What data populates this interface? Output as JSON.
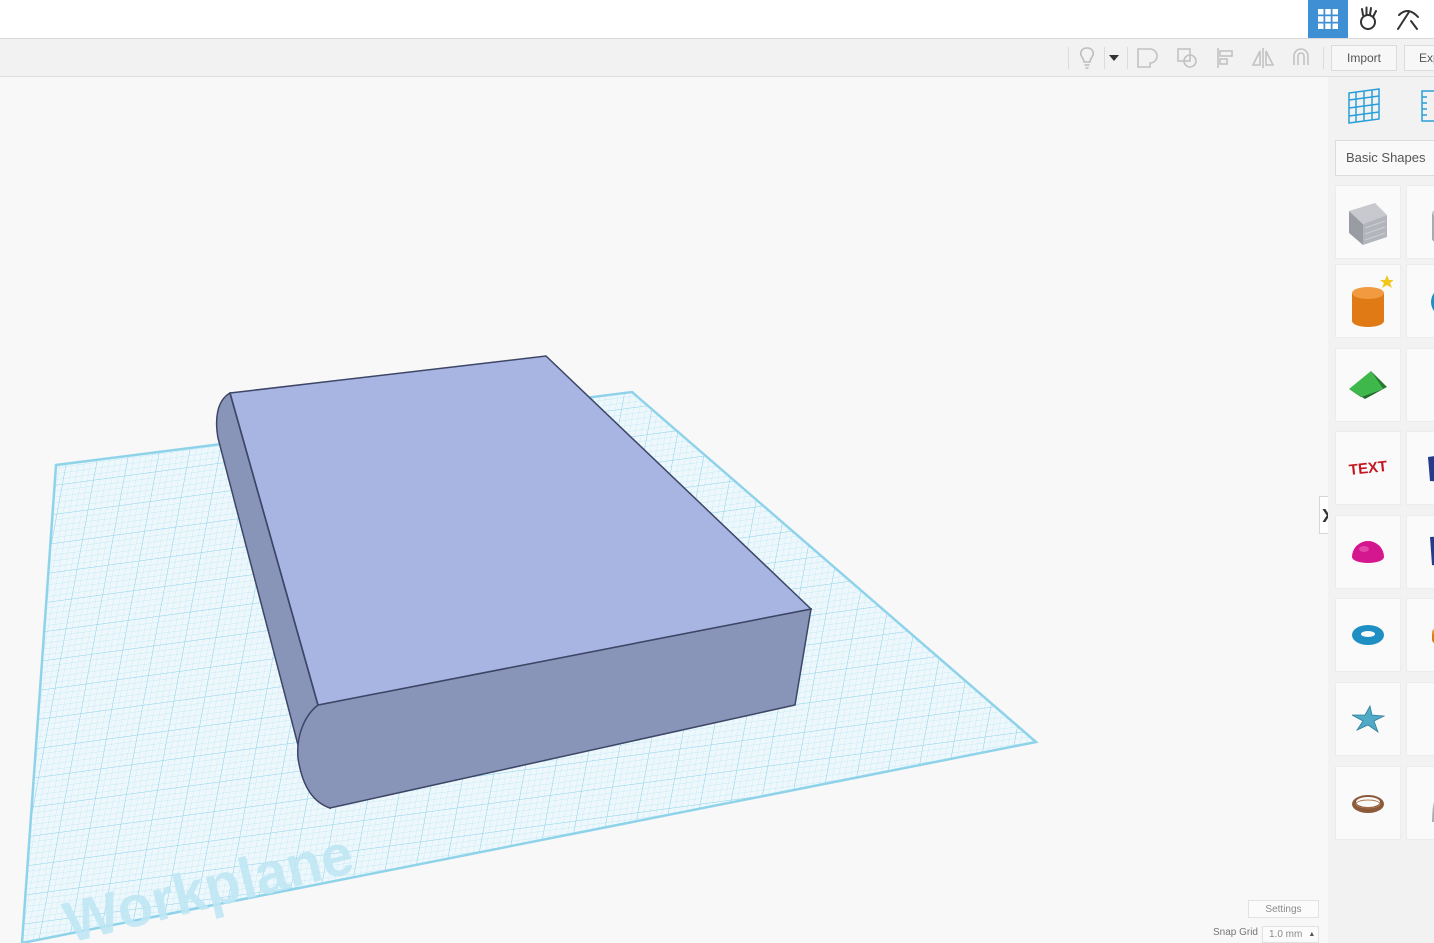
{
  "topbar": {
    "buttons": [
      {
        "name": "3d-design-view",
        "icon": "grid-icon",
        "active": true
      },
      {
        "name": "bricks-view",
        "icon": "hand-icon",
        "active": false
      },
      {
        "name": "blocks-view",
        "icon": "pickaxe-icon",
        "active": false
      }
    ]
  },
  "toolbar": {
    "icons": [
      "lightbulb-icon",
      "dropdown-caret-icon",
      "group-icon",
      "ungroup-icon",
      "align-icon",
      "mirror-icon",
      "magnet-icon"
    ],
    "import_label": "Import",
    "export_label": "Exp"
  },
  "canvas": {
    "workplane_label": "Workplane",
    "shape": {
      "type": "rounded-box",
      "top_color": "#a8b5e2",
      "side_color": "#8894b8"
    },
    "grid_color": "#8fd3ea"
  },
  "panel": {
    "category_label": "Basic Shapes",
    "view_icons": [
      "workplane-icon",
      "ruler-icon"
    ],
    "shapes": [
      {
        "name": "box",
        "color": "#a9abb3"
      },
      {
        "name": "cylinder-partial",
        "color": "#a9abb3"
      },
      {
        "name": "cylinder",
        "color": "#e8841f"
      },
      {
        "name": "sphere-partial",
        "color": "#1e8fc3"
      },
      {
        "name": "roof",
        "color": "#2e9e3a"
      },
      {
        "name": "cone-partial",
        "color": "#7b2d94"
      },
      {
        "name": "text",
        "color": "#cc1f2b"
      },
      {
        "name": "wedge-partial",
        "color": "#263b8c"
      },
      {
        "name": "half-sphere",
        "color": "#d4168f"
      },
      {
        "name": "pyramid-partial",
        "color": "#263b8c"
      },
      {
        "name": "torus",
        "color": "#1e8fc3"
      },
      {
        "name": "tube-partial",
        "color": "#e8841f"
      },
      {
        "name": "star",
        "color": "#4fa9c7"
      },
      {
        "name": "polygon-partial",
        "color": "#e8d51f"
      },
      {
        "name": "ring",
        "color": "#8a5a3a"
      },
      {
        "name": "paraboloid-partial",
        "color": "#b0b0b0"
      }
    ]
  },
  "bottom": {
    "settings_label": "Settings",
    "snap_grid_label": "Snap Grid",
    "snap_grid_value": "1.0 mm",
    "snap_arrow": "▲"
  },
  "collapse_glyph": "❯"
}
